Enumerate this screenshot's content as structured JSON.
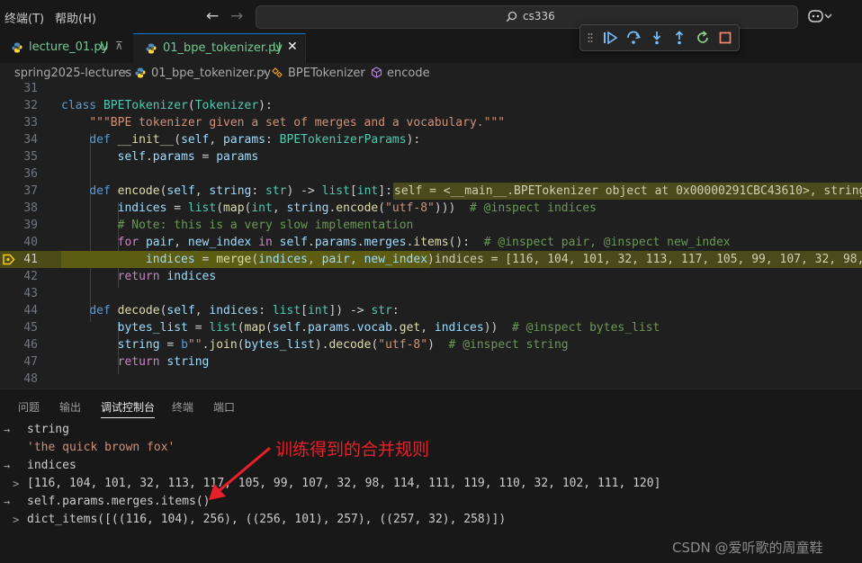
{
  "menu": {
    "terminal": "终端(T)",
    "help": "帮助(H)"
  },
  "search": {
    "text": "cs336"
  },
  "tabs": [
    {
      "name": "lecture_01.py",
      "status": "U"
    },
    {
      "name": "01_bpe_tokenizer.py",
      "status": "U"
    }
  ],
  "breadcrumb": [
    "spring2025-lectures",
    "01_bpe_tokenizer.py",
    "BPETokenizer",
    "encode"
  ],
  "editor": {
    "line_numbers": [
      "31",
      "32",
      "33",
      "34",
      "35",
      "36",
      "37",
      "38",
      "39",
      "40",
      "41",
      "42",
      "43",
      "44",
      "45",
      "46",
      "47",
      "48"
    ],
    "current_line": "41",
    "inline_values": {
      "self": "self = <__main__.BPETokenizer object at 0x00000291CBC43610>, string",
      "indices": "indices = [116, 104, 101, 32, 113, 117, 105, 99, 107, 32, 98,"
    }
  },
  "panel": {
    "tabs": [
      "问题",
      "输出",
      "调试控制台",
      "终端",
      "端口"
    ],
    "active_tab": "调试控制台"
  },
  "console": [
    {
      "mark": "→",
      "text": "string"
    },
    {
      "mark": "",
      "text": "'the quick brown fox'"
    },
    {
      "mark": "→",
      "text": "indices"
    },
    {
      "mark": ">",
      "text": "[116, 104, 101, 32, 113, 117, 105, 99, 107, 32, 98, 114, 111, 119, 110, 32, 102, 111, 120]"
    },
    {
      "mark": "→",
      "text": "self.params.merges.items()"
    },
    {
      "mark": ">",
      "text": "dict_items([((116, 104), 256), ((256, 101), 257), ((257, 32), 258)])"
    }
  ],
  "annotation": "训练得到的合并规则",
  "watermark": "CSDN @爱听歌的周童鞋",
  "colors": {
    "accent": "#0078d4",
    "annotation": "#e8202a",
    "current_line": "#4b4b18"
  }
}
